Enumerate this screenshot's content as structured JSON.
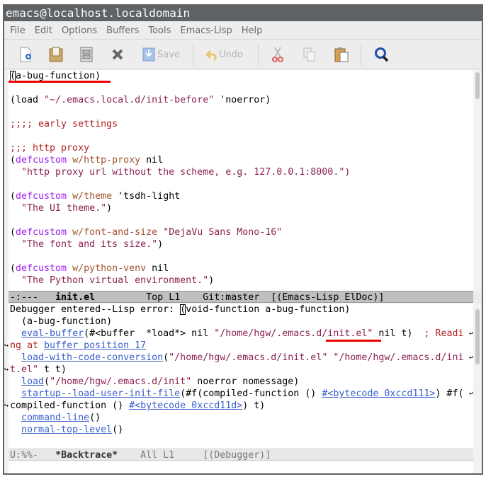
{
  "window": {
    "title": "emacs@localhost.localdomain"
  },
  "menu": [
    "File",
    "Edit",
    "Options",
    "Buffers",
    "Tools",
    "Emacs-Lisp",
    "Help"
  ],
  "toolbar": {
    "save_label": "Save",
    "undo_label": "Undo"
  },
  "colors": {
    "keyword": "#a020f0",
    "variable": "#a0522d",
    "string": "#8b2252",
    "comment": "#b22222",
    "link": "#3a5fcd"
  },
  "top_buffer": {
    "lines": [
      [
        [
          "(",
          "cur"
        ],
        [
          "a-bug-function)",
          ""
        ]
      ],
      [],
      [
        [
          "(load ",
          ""
        ],
        [
          "\"~/.emacs.local.d/init-before\"",
          "str"
        ],
        [
          " 'noerror)",
          ""
        ]
      ],
      [],
      [
        [
          ";;;; early settings",
          "cm"
        ]
      ],
      [],
      [
        [
          ";;; http proxy",
          "cm"
        ]
      ],
      [
        [
          "(",
          ""
        ],
        [
          "defcustom",
          "kw"
        ],
        [
          " ",
          ""
        ],
        [
          "w/http-proxy",
          "var"
        ],
        [
          " nil",
          ""
        ]
      ],
      [
        [
          "  ",
          ""
        ],
        [
          "\"http proxy url without the scheme, e.g. 127.0.0.1:8000.\")",
          "str"
        ]
      ],
      [],
      [
        [
          "(",
          ""
        ],
        [
          "defcustom",
          "kw"
        ],
        [
          " ",
          ""
        ],
        [
          "w/theme",
          "var"
        ],
        [
          " 'tsdh-light",
          ""
        ]
      ],
      [
        [
          "  ",
          ""
        ],
        [
          "\"The UI theme.\"",
          "str"
        ],
        [
          ")",
          ""
        ]
      ],
      [],
      [
        [
          "(",
          ""
        ],
        [
          "defcustom",
          "kw"
        ],
        [
          " ",
          ""
        ],
        [
          "w/font-and-size",
          "var"
        ],
        [
          " ",
          ""
        ],
        [
          "\"DejaVu Sans Mono-16\"",
          "str"
        ]
      ],
      [
        [
          "  ",
          ""
        ],
        [
          "\"The font and its size.\"",
          "str"
        ],
        [
          ")",
          ""
        ]
      ],
      [],
      [
        [
          "(",
          ""
        ],
        [
          "defcustom",
          "kw"
        ],
        [
          " ",
          ""
        ],
        [
          "w/python-venv",
          "var"
        ],
        [
          " nil",
          ""
        ]
      ],
      [
        [
          "  ",
          ""
        ],
        [
          "\"The Python virtual environment.\"",
          "str"
        ],
        [
          ")",
          ""
        ]
      ]
    ],
    "mode_line": {
      "status": "-:---",
      "buffer": "init.el",
      "position": "Top L1",
      "vc": "Git:master",
      "modes": "[(Emacs-Lisp ElDoc)]"
    }
  },
  "bottom_buffer": {
    "lines": [
      [
        [
          "Debugger entered--Lisp error: ",
          ""
        ],
        [
          "(",
          "cur"
        ],
        [
          "void-function a-bug-function)",
          ""
        ]
      ],
      [
        [
          "  (a-bug-function)",
          ""
        ]
      ],
      [
        [
          "  ",
          ""
        ],
        [
          "eval-buffer",
          "lnk"
        ],
        [
          "(#<buffer  *load*> nil ",
          ""
        ],
        [
          "\"/home/hgw/.emacs.d/init.el\"",
          "str"
        ],
        [
          " nil t)  ",
          ""
        ],
        [
          "; Readi",
          "cm"
        ]
      ],
      [
        [
          "ng at ",
          "cm"
        ],
        [
          "buffer position 17",
          "lnk"
        ]
      ],
      [
        [
          "  ",
          ""
        ],
        [
          "load-with-code-conversion",
          "lnk"
        ],
        [
          "(",
          ""
        ],
        [
          "\"/home/hgw/.emacs.d/init.el\" \"/home/hgw/.emacs.d/ini",
          "str"
        ]
      ],
      [
        [
          "t.el\"",
          "str"
        ],
        [
          " t t)",
          ""
        ]
      ],
      [
        [
          "  ",
          ""
        ],
        [
          "load",
          "lnk"
        ],
        [
          "(",
          ""
        ],
        [
          "\"/home/hgw/.emacs.d/init\"",
          "str"
        ],
        [
          " noerror nomessage)",
          ""
        ]
      ],
      [
        [
          "  ",
          ""
        ],
        [
          "startup--load-user-init-file",
          "lnk"
        ],
        [
          "(#f(compiled-function () ",
          ""
        ],
        [
          "#<bytecode 0xccd111>",
          "lnk"
        ],
        [
          ") #f(",
          ""
        ]
      ],
      [
        [
          "compiled-function () ",
          ""
        ],
        [
          "#<bytecode 0xccd11d>",
          "lnk"
        ],
        [
          ") t)",
          ""
        ]
      ],
      [
        [
          "  ",
          ""
        ],
        [
          "command-line",
          "lnk"
        ],
        [
          "()",
          ""
        ]
      ],
      [
        [
          "  ",
          ""
        ],
        [
          "normal-top-level",
          "lnk"
        ],
        [
          "()",
          ""
        ]
      ]
    ],
    "mode_line": {
      "status": "U:%%-",
      "buffer": "*Backtrace*",
      "position": "All L1",
      "modes": "[(Debugger)]"
    }
  }
}
